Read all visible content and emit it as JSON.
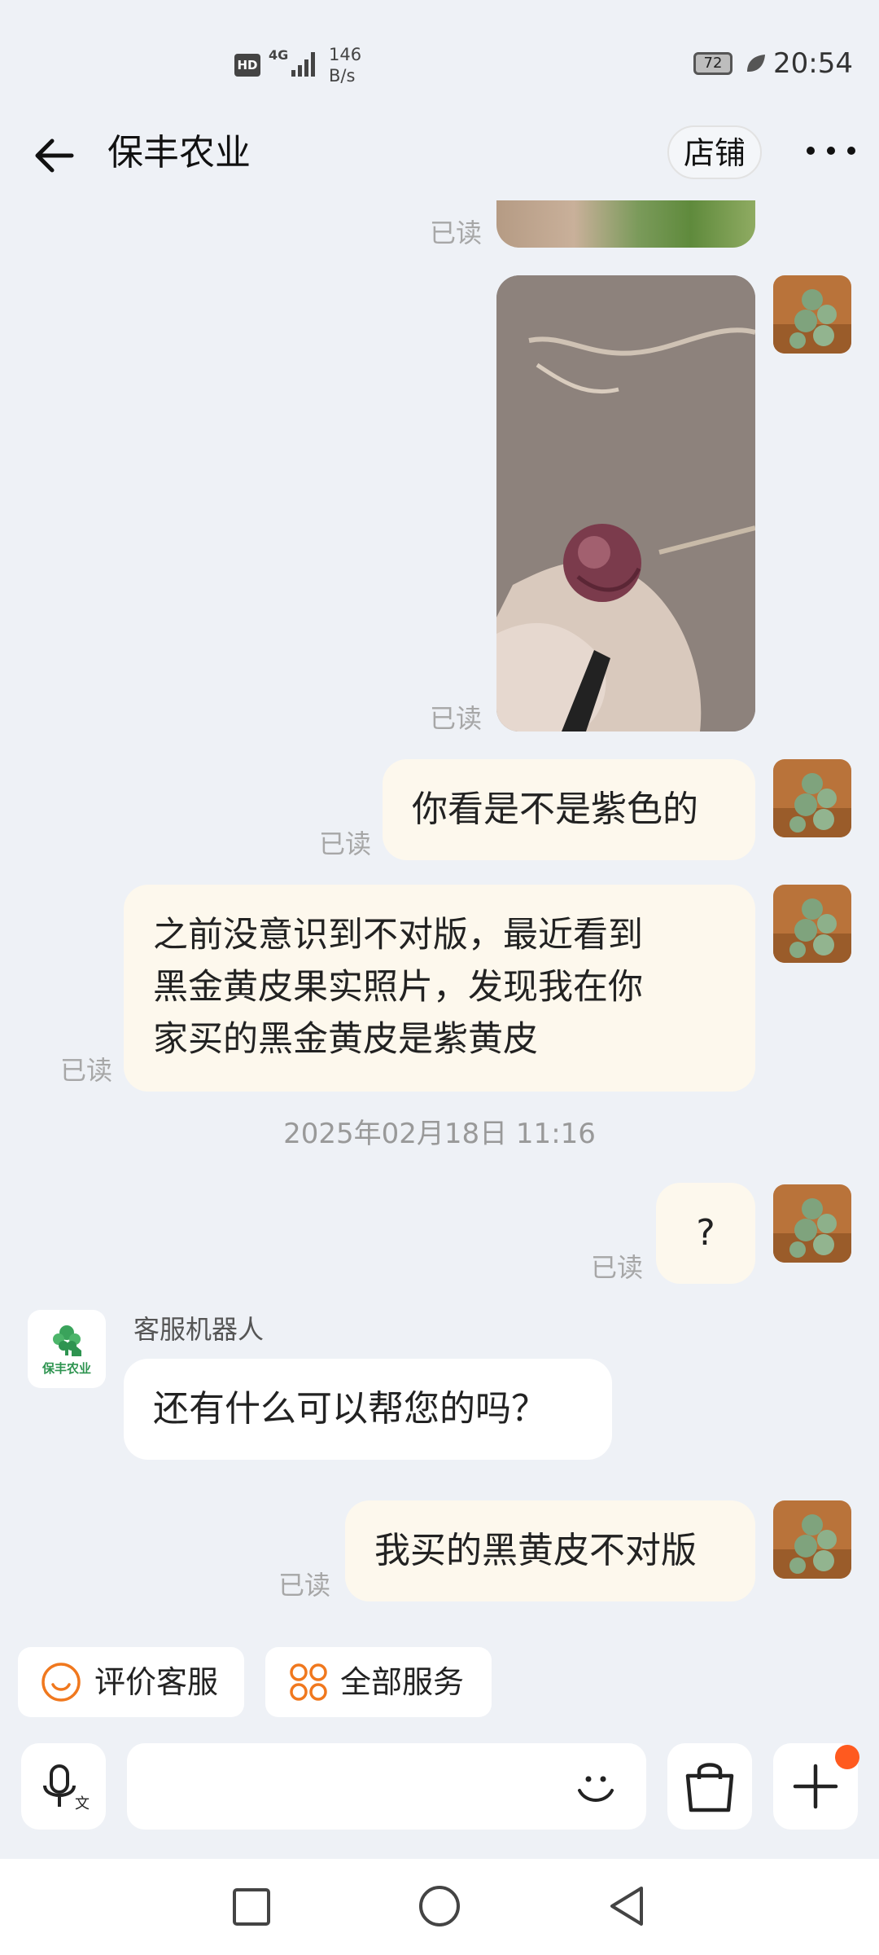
{
  "status_bar": {
    "hd": "HD",
    "network": "4G",
    "speed_value": "146",
    "speed_unit": "B/s",
    "battery": "72",
    "time": "20:54"
  },
  "header": {
    "title": "保丰农业",
    "shop_button": "店铺",
    "back_icon": "arrow-left-icon",
    "more_icon": "more-dots-icon"
  },
  "chat": {
    "read_label": "已读",
    "messages": [
      {
        "type": "image",
        "from": "user",
        "read": "已读",
        "content": "dirt-and-plants-photo-partial"
      },
      {
        "type": "image",
        "from": "user",
        "read": "已读",
        "content": "purple-fruit-in-hand-photo"
      },
      {
        "type": "text",
        "from": "user",
        "read": "已读",
        "text": "你看是不是紫色的"
      },
      {
        "type": "text",
        "from": "user",
        "read": "已读",
        "lines": [
          "之前没意识到不对版，最近看到",
          "黑金黄皮果实照片，发现我在你",
          "家买的黑金黄皮是紫黄皮"
        ]
      },
      {
        "type": "timestamp",
        "text": "2025年02月18日 11:16"
      },
      {
        "type": "text",
        "from": "user",
        "read": "已读",
        "text": "?"
      },
      {
        "type": "text",
        "from": "bot",
        "sender": "客服机器人",
        "text": "还有什么可以帮您的吗？"
      },
      {
        "type": "text",
        "from": "user",
        "read": "已读",
        "text": "我买的黑黄皮不对版"
      }
    ],
    "bot_logo_text": "保丰农业"
  },
  "quick_actions": [
    {
      "label": "评价客服",
      "icon": "smiley-icon"
    },
    {
      "label": "全部服务",
      "icon": "grid-services-icon"
    }
  ],
  "input_bar": {
    "voice_icon": "voice-translate-icon",
    "emoji_icon": "emoji-icon",
    "bag_icon": "shopping-bag-icon",
    "plus_icon": "plus-icon",
    "input_value": "",
    "badge_color": "#ff5a1f"
  },
  "nav_bar": {
    "icons": [
      "square-recents-icon",
      "circle-home-icon",
      "triangle-back-icon"
    ]
  }
}
